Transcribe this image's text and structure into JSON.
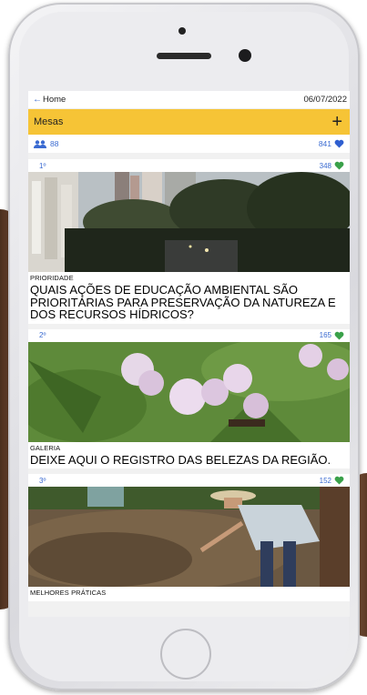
{
  "header": {
    "back_label": "Home",
    "date": "06/07/2022"
  },
  "titlebar": {
    "title": "Mesas"
  },
  "stats": {
    "participants": "88",
    "likes": "841"
  },
  "colors": {
    "accent": "#f6c436",
    "link": "#3b6bd1",
    "heart_blue": "#2f5fd0",
    "heart_green": "#3aa14a"
  },
  "cards": [
    {
      "rank": "1º",
      "likes": "348",
      "category": "PRIORIDADE",
      "question": "QUAIS AÇÕES DE EDUCAÇÃO AMBIENTAL SÃO PRIORITÁRIAS PARA PRESERVAÇÃO DA NATUREZA E DOS RECURSOS HÍDRICOS?"
    },
    {
      "rank": "2º",
      "likes": "165",
      "category": "GALERIA",
      "question": "DEIXE AQUI O REGISTRO DAS BELEZAS DA REGIÃO."
    },
    {
      "rank": "3º",
      "likes": "152",
      "category": "MELHORES PRÁTICAS",
      "question": ""
    }
  ]
}
